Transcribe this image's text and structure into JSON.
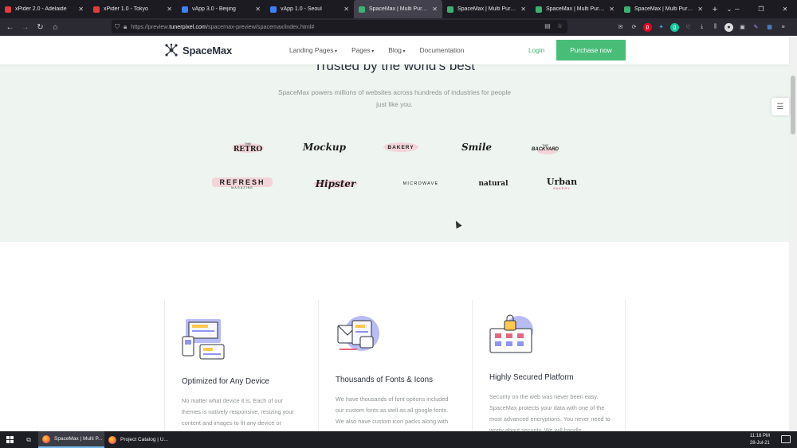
{
  "browser": {
    "tabs": [
      {
        "title": "xPider 2.0 - Adelaide",
        "color": "#e23b3b",
        "active": false
      },
      {
        "title": "xPider 1.0 - Tokyo",
        "color": "#e23b3b",
        "active": false
      },
      {
        "title": "vApp 3.0 - Beijing",
        "color": "#3b82f6",
        "active": false
      },
      {
        "title": "vApp 1.0 - Seoul",
        "color": "#3b82f6",
        "active": false
      },
      {
        "title": "SpaceMax | Multi Purpose HTML",
        "color": "#3bb273",
        "active": true
      },
      {
        "title": "SpaceMax | Multi Purpose HTML",
        "color": "#3bb273",
        "active": false
      },
      {
        "title": "SpaceMax | Multi Purpose HTML",
        "color": "#3bb273",
        "active": false
      },
      {
        "title": "SpaceMax | Multi Purpose HTML",
        "color": "#3bb273",
        "active": false
      }
    ],
    "url_prefix": "https://preview.",
    "url_domain": "tunerpixel.com",
    "url_path": "/spacemax-preview/spacemax/index.html#"
  },
  "site": {
    "logo": "SpaceMax",
    "menu": {
      "landing": "Landing Pages",
      "pages": "Pages",
      "blog": "Blog",
      "docs": "Documentation"
    },
    "login": "Login",
    "purchase": "Purchase now",
    "accent": "#47bd78"
  },
  "hero": {
    "title": "Trusted by the world's best",
    "subtitle": "SpaceMax powers millions of websites across hundreds of industries for people just like you."
  },
  "clients": {
    "retro_big": "RETRO",
    "retro_small": "The",
    "mockup_big": "Mockup",
    "bakery_big": "BAKERY",
    "smile_big": "Smile",
    "backyard_big": "BACKYARD",
    "backyard_small": "The",
    "refresh_big": "REFRESH",
    "refresh_small": "MAGAZINE",
    "hipster_big": "Hipster",
    "microwave_big": "MICROWAVE",
    "natural_big": "natural",
    "urban_big": "Urban",
    "urban_small": "Bakery"
  },
  "features": [
    {
      "title": "Optimized for Any Device",
      "text": "No matter what device it is. Each of our themes is natively responsive, resizing your content and images to fit any device or"
    },
    {
      "title": "Thousands of Fonts & Icons",
      "text": "We have thousands of font options included our custom fonts as well as all google fonts. We also have custom icon packs along with icon fonts like font awesome and pe-icon."
    },
    {
      "title": "Highly Secured Platform",
      "text": "Security on the web was never been easy. SpaceMax protects your data with one of the most advanced encryptions. You never need to worry about security. We will handle"
    }
  ],
  "taskbar": {
    "items": [
      {
        "label": "SpaceMax | Multi P..."
      },
      {
        "label": "Project Catalog | U..."
      }
    ],
    "time": "11:18 PM",
    "date": "28-Jul-21"
  }
}
